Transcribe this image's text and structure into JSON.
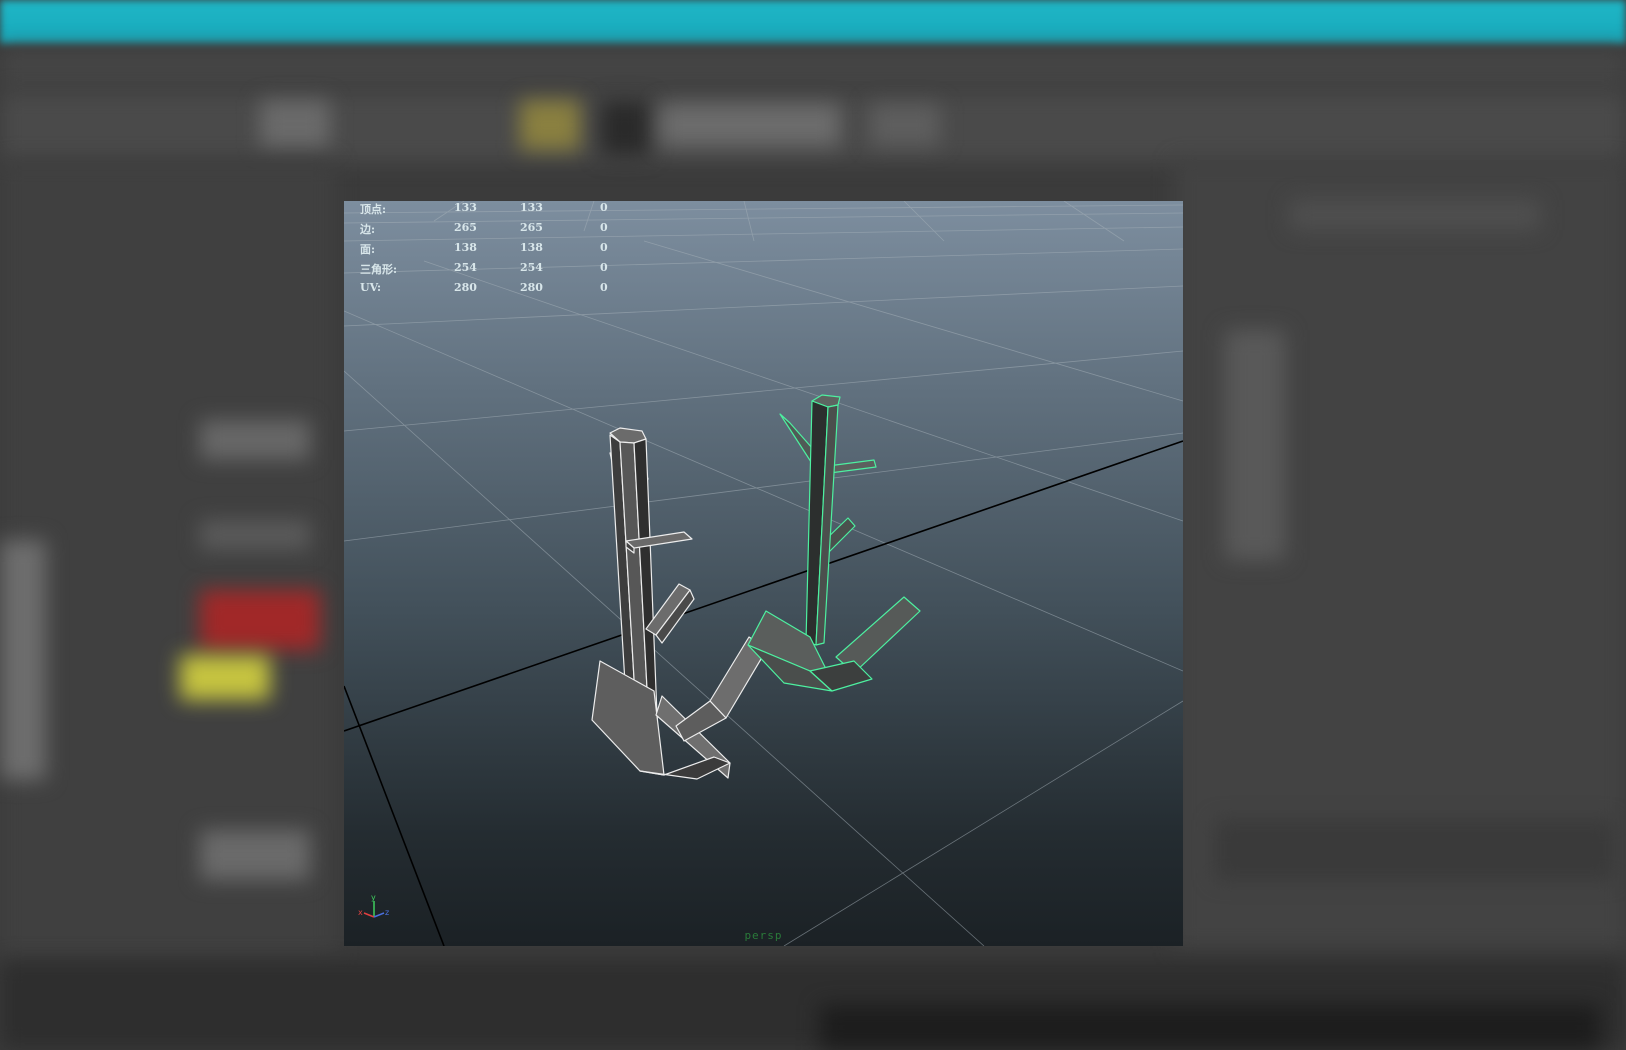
{
  "viewport": {
    "camera_label": "persp",
    "poly_count": [
      {
        "label": "顶点:",
        "v1": "133",
        "v2": "133",
        "v3": "0"
      },
      {
        "label": "边:",
        "v1": "265",
        "v2": "265",
        "v3": "0"
      },
      {
        "label": "面:",
        "v1": "138",
        "v2": "138",
        "v3": "0"
      },
      {
        "label": "三角形:",
        "v1": "254",
        "v2": "254",
        "v3": "0"
      },
      {
        "label": "UV:",
        "v1": "280",
        "v2": "280",
        "v3": "0"
      }
    ],
    "axes": {
      "x": "x",
      "y": "y",
      "z": "z"
    }
  },
  "colors": {
    "titlebar": "#17a9bb",
    "selection_wire": "#4df0a0",
    "mesh_wire": "#e8e8e8",
    "mesh_fill": "#555555",
    "grid": "#9aa6ae",
    "axis_line": "#000000"
  },
  "icons": [
    "axis-gizmo-icon"
  ]
}
